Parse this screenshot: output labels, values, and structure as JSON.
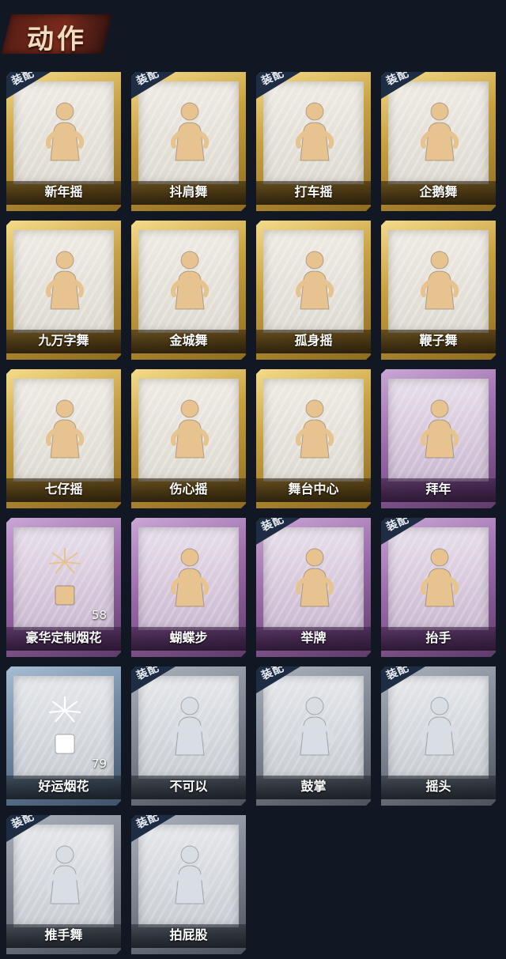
{
  "header": {
    "title": "动作"
  },
  "equip_label": "装配",
  "cards": [
    {
      "label": "新年摇",
      "tier": "gold",
      "equipped": true,
      "icon": "figure-shake-icon"
    },
    {
      "label": "抖肩舞",
      "tier": "gold",
      "equipped": true,
      "icon": "figure-shoulder-icon"
    },
    {
      "label": "打车摇",
      "tier": "gold",
      "equipped": true,
      "icon": "figure-taxi-icon"
    },
    {
      "label": "企鹅舞",
      "tier": "gold",
      "equipped": true,
      "icon": "figure-penguin-icon"
    },
    {
      "label": "九万字舞",
      "tier": "gold",
      "equipped": false,
      "icon": "figure-swirl-icon"
    },
    {
      "label": "金城舞",
      "tier": "gold",
      "equipped": false,
      "icon": "figure-wave-icon"
    },
    {
      "label": "孤身摇",
      "tier": "gold",
      "equipped": false,
      "icon": "figure-star-icon"
    },
    {
      "label": "鞭子舞",
      "tier": "gold",
      "equipped": false,
      "icon": "figure-heart-icon"
    },
    {
      "label": "七仔摇",
      "tier": "gold",
      "equipped": false,
      "icon": "figure-sparkle-icon"
    },
    {
      "label": "伤心摇",
      "tier": "gold",
      "equipped": false,
      "icon": "figure-heart-hands-icon"
    },
    {
      "label": "舞台中心",
      "tier": "gold",
      "equipped": false,
      "icon": "figure-center-icon"
    },
    {
      "label": "拜年",
      "tier": "purple",
      "equipped": false,
      "icon": "figure-bow-icon"
    },
    {
      "label": "豪华定制烟花",
      "tier": "purple",
      "equipped": false,
      "icon": "firework-box-icon",
      "count": "58"
    },
    {
      "label": "蝴蝶步",
      "tier": "purple",
      "equipped": false,
      "icon": "figure-point-icon"
    },
    {
      "label": "举牌",
      "tier": "purple",
      "equipped": true,
      "icon": "figure-sign-icon"
    },
    {
      "label": "抬手",
      "tier": "purple",
      "equipped": true,
      "icon": "figure-raise-hand-icon"
    },
    {
      "label": "好运烟花",
      "tier": "blue",
      "equipped": false,
      "icon": "firework-can-icon",
      "count": "79"
    },
    {
      "label": "不可以",
      "tier": "grey",
      "equipped": true,
      "icon": "finger-no-icon"
    },
    {
      "label": "鼓掌",
      "tier": "grey",
      "equipped": true,
      "icon": "clap-hands-icon"
    },
    {
      "label": "摇头",
      "tier": "grey",
      "equipped": true,
      "icon": "figure-head-shake-icon"
    },
    {
      "label": "推手舞",
      "tier": "grey",
      "equipped": true,
      "icon": "figure-push-icon"
    },
    {
      "label": "拍屁股",
      "tier": "grey",
      "equipped": true,
      "icon": "figure-slap-icon"
    }
  ]
}
